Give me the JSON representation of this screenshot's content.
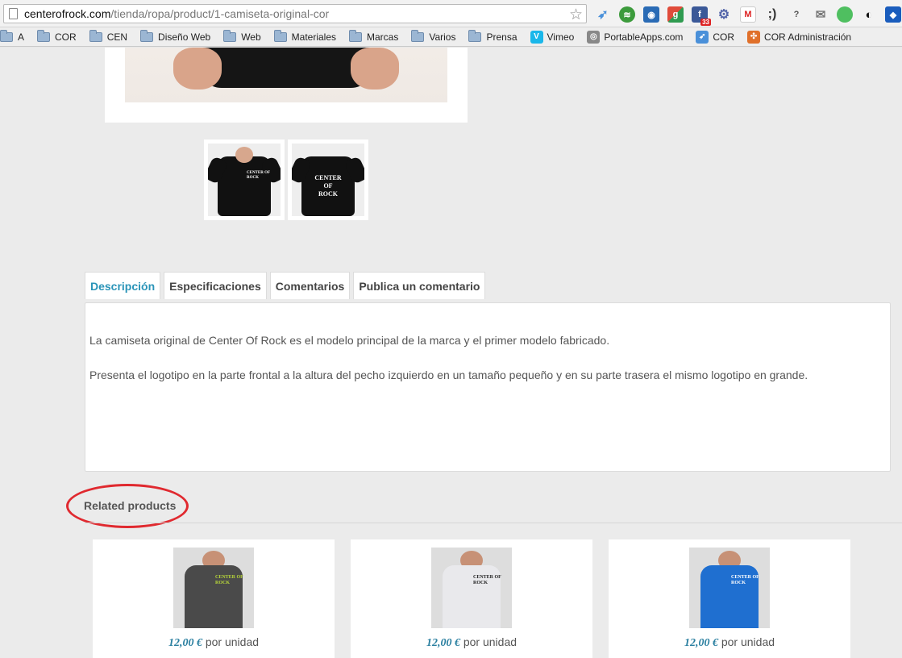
{
  "browser": {
    "url_host": "centerofrock.com",
    "url_path": "/tienda/ropa/product/1-camiseta-original-cor",
    "bookmarks": [
      {
        "label": "A",
        "icon": "folder-icon"
      },
      {
        "label": "COR",
        "icon": "folder-icon"
      },
      {
        "label": "CEN",
        "icon": "folder-icon"
      },
      {
        "label": "Diseño Web",
        "icon": "folder-icon"
      },
      {
        "label": "Web",
        "icon": "folder-icon"
      },
      {
        "label": "Materiales",
        "icon": "folder-icon"
      },
      {
        "label": "Marcas",
        "icon": "folder-icon"
      },
      {
        "label": "Varios",
        "icon": "folder-icon"
      },
      {
        "label": "Prensa",
        "icon": "folder-icon"
      },
      {
        "label": "Vimeo",
        "icon": "vimeo-icon"
      },
      {
        "label": "PortableApps.com",
        "icon": "portableapps-icon"
      },
      {
        "label": "COR",
        "icon": "cor-bookmark-icon"
      },
      {
        "label": "COR Administración",
        "icon": "joomla-icon"
      }
    ],
    "extension_badge": "33"
  },
  "product": {
    "thumb_logo_line1": "CENTER OF",
    "thumb_logo_line2": "ROCK"
  },
  "tabs": [
    {
      "label": "Descripción",
      "active": true
    },
    {
      "label": "Especificaciones",
      "active": false
    },
    {
      "label": "Comentarios",
      "active": false
    },
    {
      "label": "Publica un comentario",
      "active": false
    }
  ],
  "description": {
    "paragraph1": "La camiseta original de Center Of Rock es el modelo principal de la marca y el primer modelo fabricado.",
    "paragraph2": "Presenta el logotipo en la parte frontal a la altura del pecho izquierdo en un tamaño pequeño y en su parte trasera el mismo logotipo en grande."
  },
  "related": {
    "title": "Related products",
    "products": [
      {
        "price": "12,00 €",
        "unit": "por unidad",
        "shirt_color": "#4a4a4a",
        "logo_color": "#b7d63a"
      },
      {
        "price": "12,00 €",
        "unit": "por unidad",
        "shirt_color": "#e9e9ec",
        "logo_color": "#222222"
      },
      {
        "price": "12,00 €",
        "unit": "por unidad",
        "shirt_color": "#1f6fd0",
        "logo_color": "#ffffff"
      }
    ]
  },
  "colors": {
    "accent": "#2a94b8",
    "annotation": "#e0292f"
  }
}
